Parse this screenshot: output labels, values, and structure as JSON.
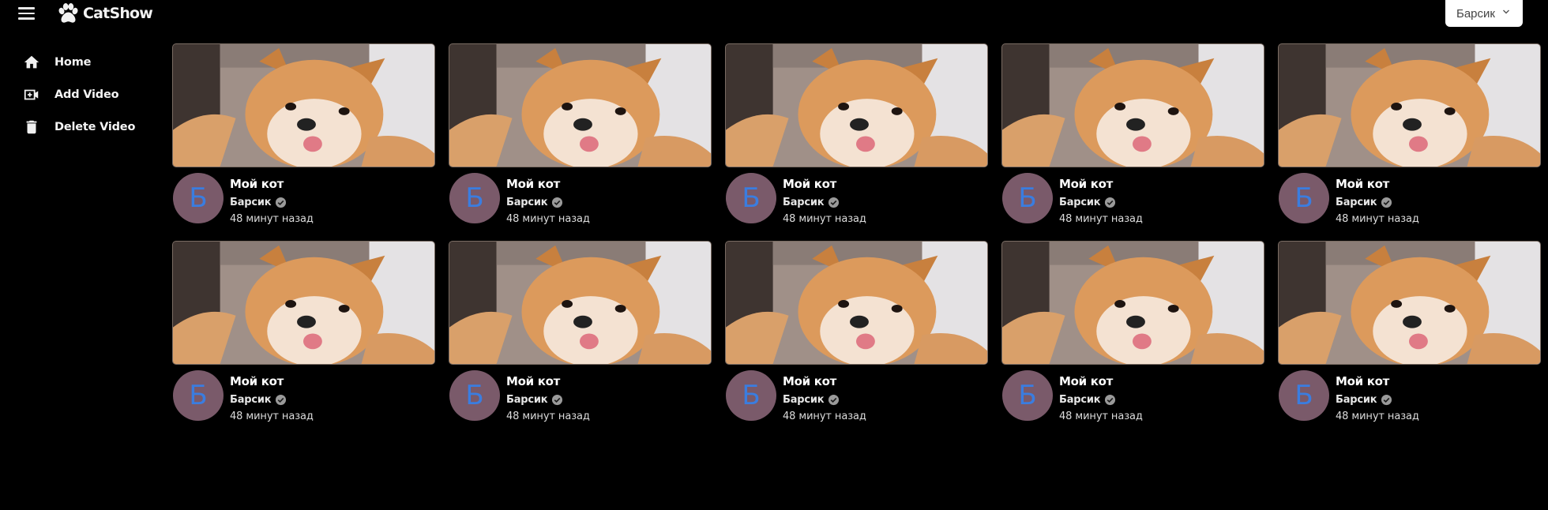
{
  "header": {
    "menu_icon": "hamburger-menu-icon",
    "logo_icon": "paw-icon",
    "logo_text": "CatShow",
    "account_label": "Барсик",
    "account_icon": "chevron-down-icon"
  },
  "sidebar": {
    "items": [
      {
        "label": "Home",
        "icon": "home-icon"
      },
      {
        "label": "Add Video",
        "icon": "video-plus-icon"
      },
      {
        "label": "Delete Video",
        "icon": "trash-icon"
      }
    ]
  },
  "videos": [
    {
      "title": "Мой кот",
      "channel": "Барсик",
      "avatar_letter": "Б",
      "time": "48 минут назад"
    },
    {
      "title": "Мой кот",
      "channel": "Барсик",
      "avatar_letter": "Б",
      "time": "48 минут назад"
    },
    {
      "title": "Мой кот",
      "channel": "Барсик",
      "avatar_letter": "Б",
      "time": "48 минут назад"
    },
    {
      "title": "Мой кот",
      "channel": "Барсик",
      "avatar_letter": "Б",
      "time": "48 минут назад"
    },
    {
      "title": "Мой кот",
      "channel": "Барсик",
      "avatar_letter": "Б",
      "time": "48 минут назад"
    },
    {
      "title": "Мой кот",
      "channel": "Барсик",
      "avatar_letter": "Б",
      "time": "48 минут назад"
    },
    {
      "title": "Мой кот",
      "channel": "Барсик",
      "avatar_letter": "Б",
      "time": "48 минут назад"
    },
    {
      "title": "Мой кот",
      "channel": "Барсик",
      "avatar_letter": "Б",
      "time": "48 минут назад"
    },
    {
      "title": "Мой кот",
      "channel": "Барсик",
      "avatar_letter": "Б",
      "time": "48 минут назад"
    },
    {
      "title": "Мой кот",
      "channel": "Барсик",
      "avatar_letter": "Б",
      "time": "48 минут назад"
    }
  ],
  "colors": {
    "background": "#000000",
    "avatar_bg": "#7a5a6a",
    "avatar_letter": "#3a7de0"
  }
}
